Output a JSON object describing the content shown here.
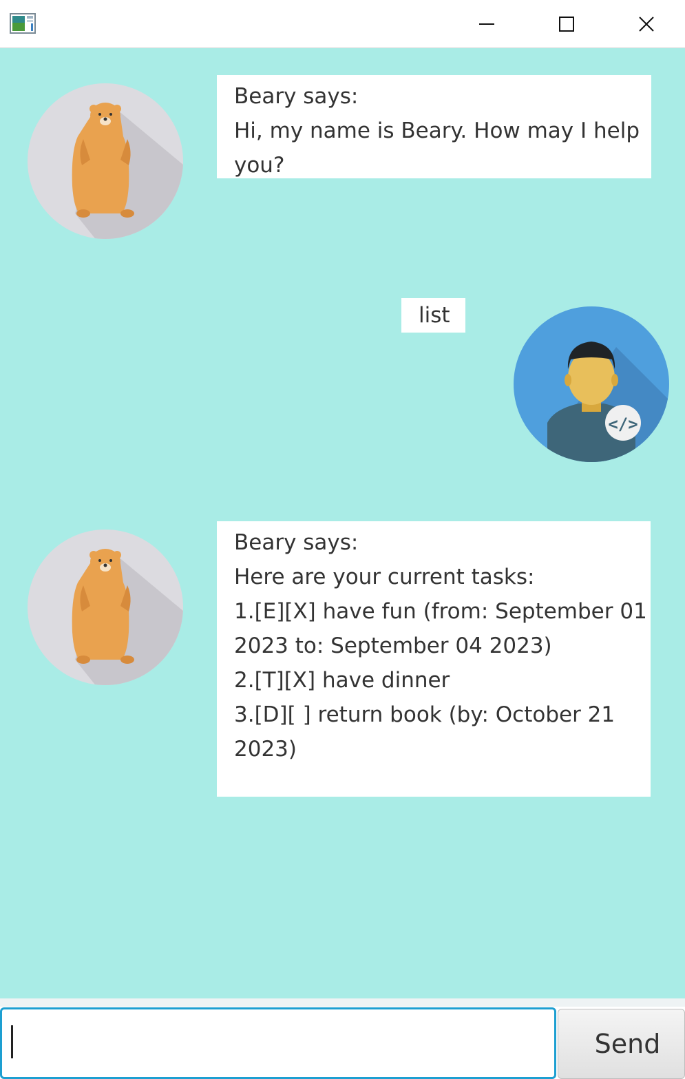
{
  "window": {
    "controls": {
      "minimize": "minimize-icon",
      "maximize": "maximize-icon",
      "close": "close-icon"
    }
  },
  "messages": [
    {
      "sender": "Beary",
      "lines": [
        "Beary says:",
        "Hi, my name is Beary. How may I help",
        "you?"
      ]
    },
    {
      "sender": "user",
      "lines": [
        "list"
      ]
    },
    {
      "sender": "Beary",
      "lines": [
        "Beary says:",
        "Here are your current tasks:",
        "1.[E][X] have fun (from: September 01",
        "2023 to: September 04 2023)",
        "2.[T][X] have dinner",
        "3.[D][ ] return book (by: October 21",
        "2023)"
      ]
    }
  ],
  "input": {
    "value": "",
    "placeholder": ""
  },
  "send_label": "Send",
  "colors": {
    "chat_background": "#a9ece6",
    "bubble": "#ffffff",
    "input_focus": "#1d9fd1",
    "bear_avatar_bg": "#dcdbe0",
    "user_avatar_bg": "#4f9fdd"
  }
}
